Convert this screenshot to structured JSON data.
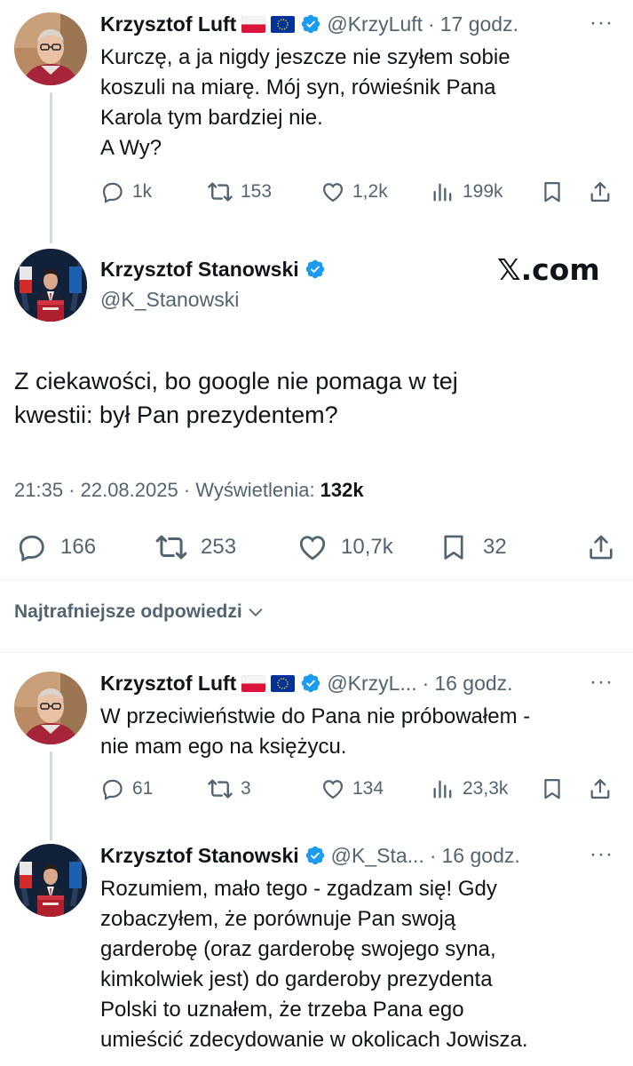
{
  "tweet1": {
    "name": "Krzysztof Luft",
    "handle": "@KrzyLuft",
    "time": "17 godz.",
    "text": "Kurczę, a ja nigdy jeszcze nie szyłem sobie\nkoszuli na miarę. Mój syn, rówieśnik Pana\nKarola tym bardziej nie.\nA Wy?",
    "replies": "1k",
    "reposts": "153",
    "likes": "1,2k",
    "views": "199k"
  },
  "main": {
    "name": "Krzysztof Stanowski",
    "handle": "@K_Stanowski",
    "watermark": "𝕏.com",
    "text": "Z ciekawości, bo google nie pomaga w tej\nkwestii: był Pan prezydentem?",
    "timestamp": "21:35 · 22.08.2025 · ",
    "views_label": "Wyświetlenia: ",
    "views_value": "132k",
    "replies": "166",
    "reposts": "253",
    "likes": "10,7k",
    "bookmarks": "32"
  },
  "sort": {
    "label": "Najtrafniejsze odpowiedzi"
  },
  "reply1": {
    "name": "Krzysztof Luft",
    "handle": "@KrzyL...",
    "time": "16 godz.",
    "text": "W przeciwieństwie do Pana nie próbowałem -\nnie mam ego na księżycu.",
    "replies": "61",
    "reposts": "3",
    "likes": "134",
    "views": "23,3k"
  },
  "reply2": {
    "name": "Krzysztof Stanowski",
    "handle": "@K_Sta...",
    "time": "16 godz.",
    "text": "Rozumiem, mało tego - zgadzam się! Gdy\nzobaczyłem, że porównuje Pan swoją\ngarderobę (oraz garderobę swojego syna,\nkimkolwiek jest) do garderoby prezydenta\nPolski to uznałem, że trzeba Pana ego\numieścić zdecydowanie w okolicach Jowisza."
  },
  "colors": {
    "verified": "#1d9bf0",
    "muted": "#536471",
    "text": "#0f1419"
  }
}
